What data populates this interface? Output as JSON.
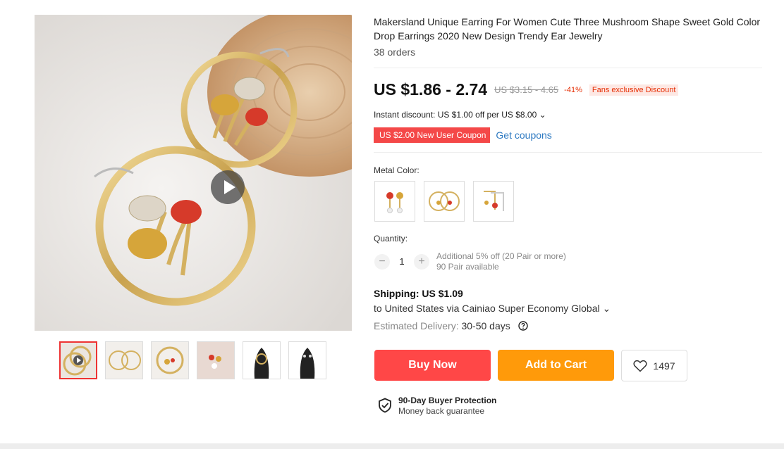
{
  "product": {
    "title": "Makersland Unique Earring For Women Cute Three Mushroom Shape Sweet Gold Color Drop Earrings 2020 New Design Trendy Ear Jewelry",
    "orders": "38 orders"
  },
  "price": {
    "current": "US $1.86 - 2.74",
    "original": "US $3.15 - 4.65",
    "discount_pct": "-41%",
    "fans_badge": "Fans exclusive Discount",
    "instant_discount": "Instant discount: US $1.00 off per US $8.00 ⌄",
    "coupon_tag": "US $2.00 New User Coupon",
    "get_coupons": "Get coupons"
  },
  "variants": {
    "label": "Metal Color:",
    "options": [
      "mushroom-stud-drop",
      "hoop-gold",
      "hoop-open-side"
    ]
  },
  "quantity": {
    "label": "Quantity:",
    "value": "1",
    "minus": "−",
    "plus": "+",
    "additional": "Additional 5% off (20 Pair or more)",
    "available": "90 Pair available"
  },
  "shipping": {
    "title": "Shipping: US $1.09",
    "to": "to United States via Cainiao Super Economy Global ⌄",
    "estimated_label": "Estimated Delivery:",
    "estimated_value": "30-50 days"
  },
  "actions": {
    "buy_now": "Buy Now",
    "add_to_cart": "Add to Cart",
    "wishlist_count": "1497"
  },
  "protection": {
    "title": "90-Day Buyer Protection",
    "subtitle": "Money back guarantee"
  },
  "colors": {
    "buy": "#ff4747",
    "cart": "#ff9a0a",
    "coupon": "#f44848",
    "link": "#2e7ac2",
    "discount": "#e62e04"
  }
}
